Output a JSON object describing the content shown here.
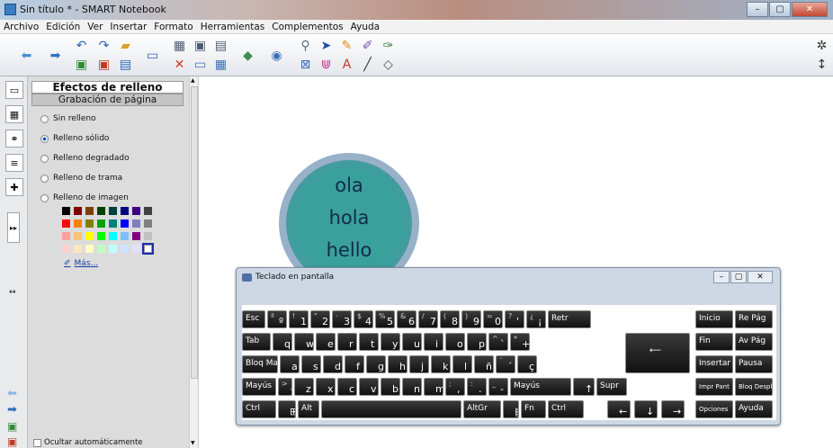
{
  "window": {
    "title": "Sin título * - SMART Notebook",
    "min": "–",
    "max": "▢",
    "close": "✕"
  },
  "menu": [
    "Archivo",
    "Edición",
    "Ver",
    "Insertar",
    "Formato",
    "Herramientas",
    "Complementos",
    "Ayuda"
  ],
  "panel": {
    "title": "Efectos de relleno",
    "subtitle": "Grabación de página",
    "fill_options": [
      {
        "label": "Sin relleno",
        "selected": false
      },
      {
        "label": "Relleno sólido",
        "selected": true
      },
      {
        "label": "Relleno degradado",
        "selected": false
      },
      {
        "label": "Relleno de trama",
        "selected": false
      },
      {
        "label": "Relleno de imagen",
        "selected": false
      }
    ],
    "palette": [
      "#000000",
      "#7f0000",
      "#7f3f00",
      "#004000",
      "#003f3f",
      "#000080",
      "#3f007f",
      "#404040",
      "#ff0000",
      "#ff7f00",
      "#7f7f00",
      "#00a000",
      "#007f7f",
      "#0000ff",
      "#7f7fbf",
      "#808080",
      "#ff9f9f",
      "#ffbf7f",
      "#ffff00",
      "#00ff00",
      "#00ffff",
      "#7fbfff",
      "#7f007f",
      "#c0c0c0",
      "#ffd0d0",
      "#ffe6bf",
      "#ffffbf",
      "#bfffbf",
      "#bfffff",
      "#cfe3ff",
      "#e0e0ff",
      "#ffffff"
    ],
    "selected_color_index": 31,
    "more_link": "Más...",
    "autohide_label": "Ocultar automáticamente"
  },
  "canvas": {
    "circle_words": [
      "ola",
      "hola",
      "hello"
    ],
    "circle_fill": "#3aa09c",
    "circle_border": "#98b1c8"
  },
  "osk": {
    "title": "Teclado en pantalla",
    "rows": [
      [
        [
          "Esc",
          ""
        ],
        [
          "º",
          "ª"
        ],
        [
          "1",
          "!"
        ],
        [
          "2",
          "\""
        ],
        [
          "3",
          "·"
        ],
        [
          "4",
          "$"
        ],
        [
          "5",
          "%"
        ],
        [
          "6",
          "&"
        ],
        [
          "7",
          "/"
        ],
        [
          "8",
          "("
        ],
        [
          "9",
          ")"
        ],
        [
          "0",
          "="
        ],
        [
          "'",
          "?"
        ],
        [
          "¡",
          "¿"
        ],
        [
          "Retr",
          ""
        ],
        [
          "Inicio",
          ""
        ],
        [
          "Re Pág",
          ""
        ]
      ],
      [
        [
          "Tab",
          ""
        ],
        [
          "q",
          ""
        ],
        [
          "w",
          ""
        ],
        [
          "e",
          ""
        ],
        [
          "r",
          ""
        ],
        [
          "t",
          ""
        ],
        [
          "y",
          ""
        ],
        [
          "u",
          ""
        ],
        [
          "i",
          ""
        ],
        [
          "o",
          ""
        ],
        [
          "p",
          ""
        ],
        [
          "`",
          "^"
        ],
        [
          "+",
          "*"
        ],
        [
          "Fin",
          ""
        ],
        [
          "Av Pág",
          ""
        ]
      ],
      [
        [
          "Bloq May",
          ""
        ],
        [
          "a",
          ""
        ],
        [
          "s",
          ""
        ],
        [
          "d",
          ""
        ],
        [
          "f",
          ""
        ],
        [
          "g",
          ""
        ],
        [
          "h",
          ""
        ],
        [
          "j",
          ""
        ],
        [
          "k",
          ""
        ],
        [
          "l",
          ""
        ],
        [
          "ñ",
          ""
        ],
        [
          "´",
          "¨"
        ],
        [
          "ç",
          ""
        ],
        [
          "Insertar",
          ""
        ],
        [
          "Pausa",
          ""
        ]
      ],
      [
        [
          "Mayús",
          ""
        ],
        [
          "<",
          ">"
        ],
        [
          "z",
          ""
        ],
        [
          "x",
          ""
        ],
        [
          "c",
          ""
        ],
        [
          "v",
          ""
        ],
        [
          "b",
          ""
        ],
        [
          "n",
          ""
        ],
        [
          "m",
          ""
        ],
        [
          ",",
          ";"
        ],
        [
          ".",
          ":"
        ],
        [
          "-",
          "_"
        ],
        [
          "Mayús",
          ""
        ],
        [
          "↑",
          ""
        ],
        [
          "Supr",
          ""
        ],
        [
          "Impr Pant",
          ""
        ],
        [
          "Bloq Despl",
          ""
        ]
      ],
      [
        [
          "Ctrl",
          ""
        ],
        [
          "⊞",
          ""
        ],
        [
          "Alt",
          ""
        ],
        [
          "",
          ""
        ],
        [
          "AltGr",
          ""
        ],
        [
          "▤",
          ""
        ],
        [
          "Fn",
          ""
        ],
        [
          "Ctrl",
          ""
        ],
        [
          "←",
          ""
        ],
        [
          "↓",
          ""
        ],
        [
          "→",
          ""
        ],
        [
          "Opciones",
          ""
        ],
        [
          "Ayuda",
          ""
        ]
      ]
    ]
  }
}
